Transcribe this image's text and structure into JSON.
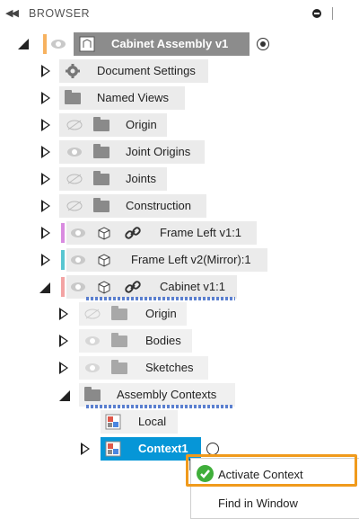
{
  "header": {
    "title": "BROWSER"
  },
  "tree": {
    "root": "Cabinet Assembly v1",
    "document_settings": "Document Settings",
    "named_views": "Named Views",
    "origin": "Origin",
    "joint_origins": "Joint Origins",
    "joints": "Joints",
    "construction": "Construction",
    "frame_left_1": "Frame Left v1:1",
    "frame_left_2": "Frame Left v2(Mirror):1",
    "cabinet": "Cabinet v1:1",
    "cabinet_origin": "Origin",
    "bodies": "Bodies",
    "sketches": "Sketches",
    "assembly_contexts": "Assembly Contexts",
    "local": "Local",
    "context1": "Context1"
  },
  "context_menu": {
    "activate_context": "Activate Context",
    "find_in_window": "Find in Window"
  },
  "colors": {
    "selected": "#0696d7",
    "highlight_border": "#f09a1c",
    "frame_left_1_bar": "#d98be0",
    "frame_left_2_bar": "#58c6d1",
    "cabinet_bar": "#f3a3a3",
    "root_bar": "#f7b25f"
  }
}
